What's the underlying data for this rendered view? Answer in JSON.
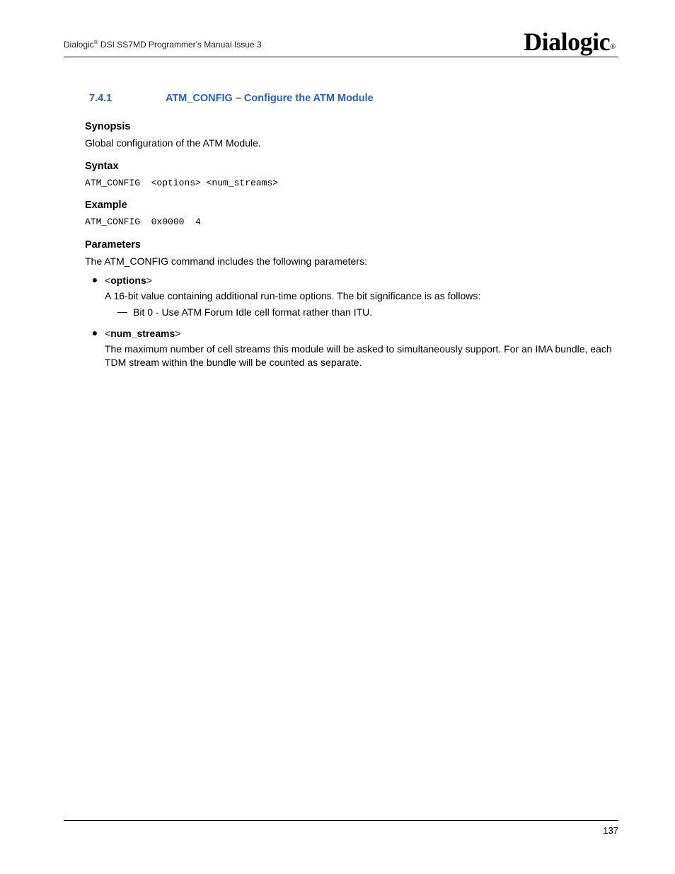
{
  "header": {
    "doc_title_prefix": "Dialogic",
    "doc_title_suffix": " DSI SS7MD Programmer's Manual  Issue 3",
    "logo_text": "Dialogic",
    "registered": "®"
  },
  "section": {
    "number": "7.4.1",
    "title": "ATM_CONFIG – Configure the ATM Module"
  },
  "synopsis": {
    "heading": "Synopsis",
    "text": "Global configuration of the ATM Module."
  },
  "syntax": {
    "heading": "Syntax",
    "code": "ATM_CONFIG  <options> <num_streams>"
  },
  "example": {
    "heading": "Example",
    "code": "ATM_CONFIG  0x0000  4"
  },
  "parameters": {
    "heading": "Parameters",
    "intro": "The ATM_CONFIG command includes the following parameters:",
    "items": [
      {
        "name": "options",
        "desc": "A 16-bit value containing additional run-time options. The bit significance is as follows:",
        "sub": "Bit 0 - Use ATM Forum Idle cell format rather than ITU."
      },
      {
        "name": "num_streams",
        "desc": "The maximum number of cell streams this module will be asked to simultaneously support. For an IMA bundle, each TDM stream within the bundle will be counted as separate."
      }
    ]
  },
  "footer": {
    "page_number": "137"
  }
}
